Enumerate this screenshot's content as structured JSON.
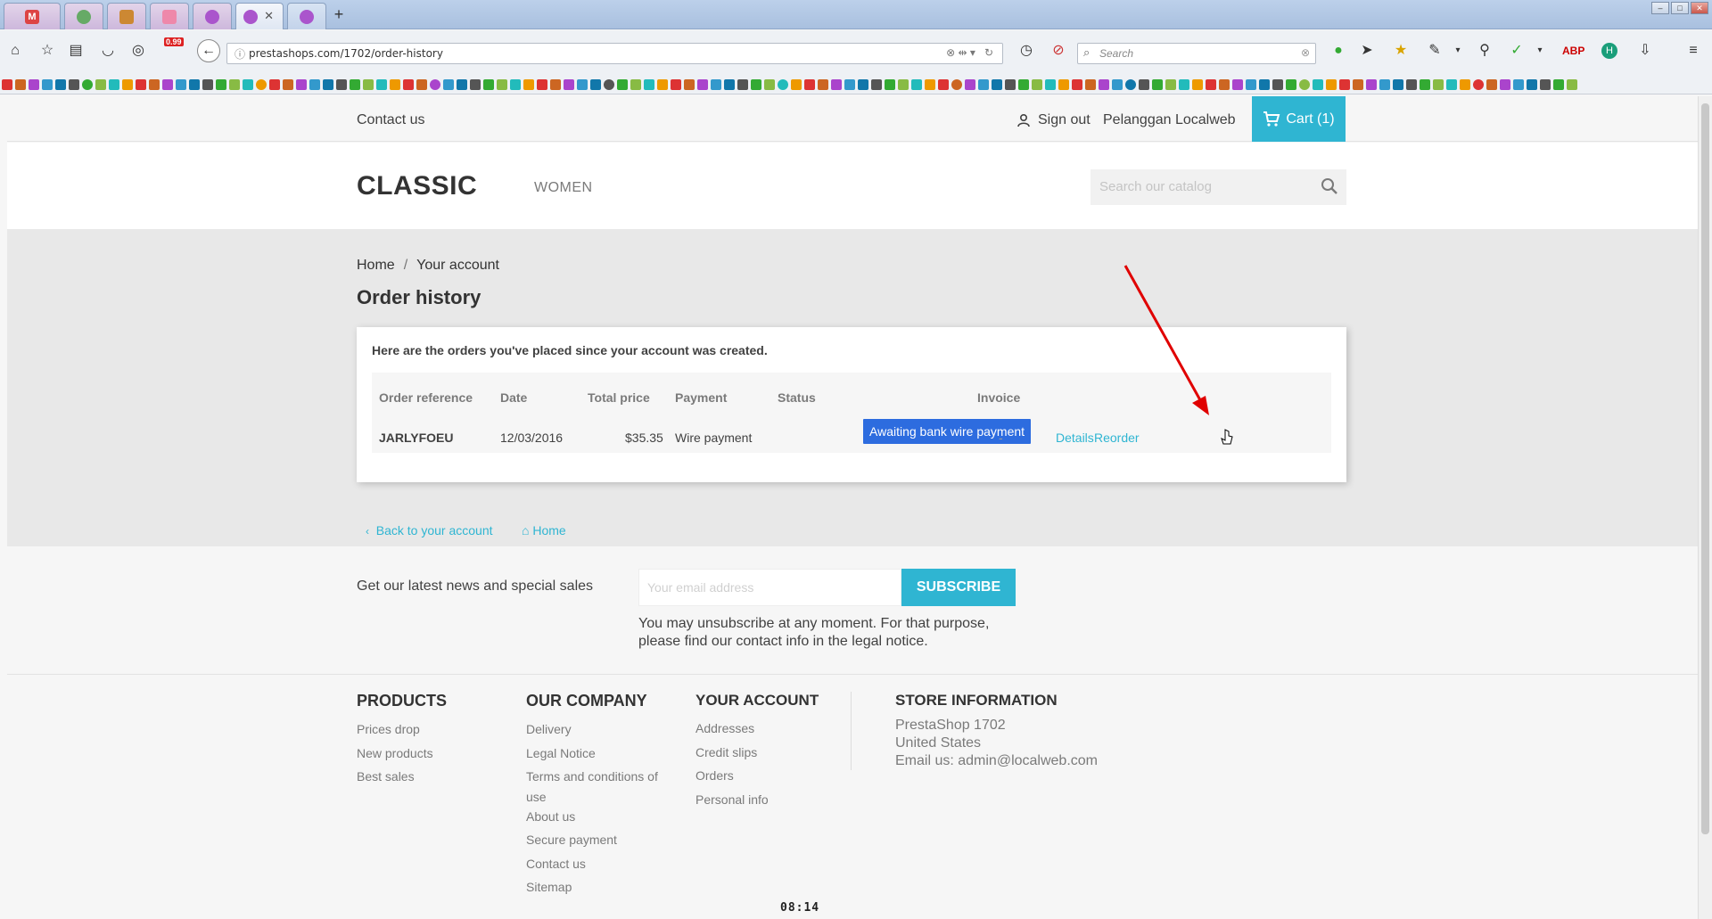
{
  "browser": {
    "url": "prestashops.com/1702/order-history",
    "search_placeholder": "Search",
    "badge": "0.99",
    "tab_count_new": "+"
  },
  "topnav": {
    "contact": "Contact us",
    "sign_out": "Sign out",
    "user_name": "Pelanggan Localweb",
    "cart": "Cart (1)"
  },
  "header": {
    "logo": "CLASSIC",
    "menu_women": "WOMEN",
    "search_placeholder": "Search our catalog"
  },
  "breadcrumb": {
    "home": "Home",
    "separator": "/",
    "account": "Your account"
  },
  "page_title": "Order history",
  "orders": {
    "intro": "Here are the orders you've placed since your account was created.",
    "columns": [
      "Order reference",
      "Date",
      "Total price",
      "Payment",
      "Status",
      "Invoice"
    ],
    "rows": [
      {
        "reference": "JARLYFOEU",
        "date": "12/03/2016",
        "total": "$35.35",
        "payment": "Wire payment",
        "status": "Awaiting bank wire payment",
        "invoice": "-",
        "details": "Details",
        "reorder": "Reorder"
      }
    ]
  },
  "links": {
    "back": "Back to your account",
    "home": "Home"
  },
  "newsletter": {
    "text": "Get our latest news and special sales",
    "placeholder": "Your email address",
    "button": "SUBSCRIBE",
    "note": "You may unsubscribe at any moment. For that purpose, please find our contact info in the legal notice."
  },
  "footer": {
    "products": {
      "title": "PRODUCTS",
      "links": [
        "Prices drop",
        "New products",
        "Best sales"
      ]
    },
    "company": {
      "title": "OUR COMPANY",
      "links": [
        "Delivery",
        "Legal Notice",
        "Terms and conditions of",
        "use",
        "About us",
        "Secure payment",
        "Contact us",
        "Sitemap"
      ]
    },
    "account": {
      "title": "YOUR ACCOUNT",
      "links": [
        "Addresses",
        "Credit slips",
        "Orders",
        "Personal info"
      ]
    },
    "store": {
      "title": "STORE INFORMATION",
      "lines": [
        "PrestaShop 1702",
        "United States",
        "Email us: admin@localweb.com"
      ]
    }
  },
  "clock": "08:14",
  "colors": {
    "accent": "#2fb5d2",
    "status_blue": "#2d6cdf",
    "annotation_arrow": "#e00000"
  }
}
